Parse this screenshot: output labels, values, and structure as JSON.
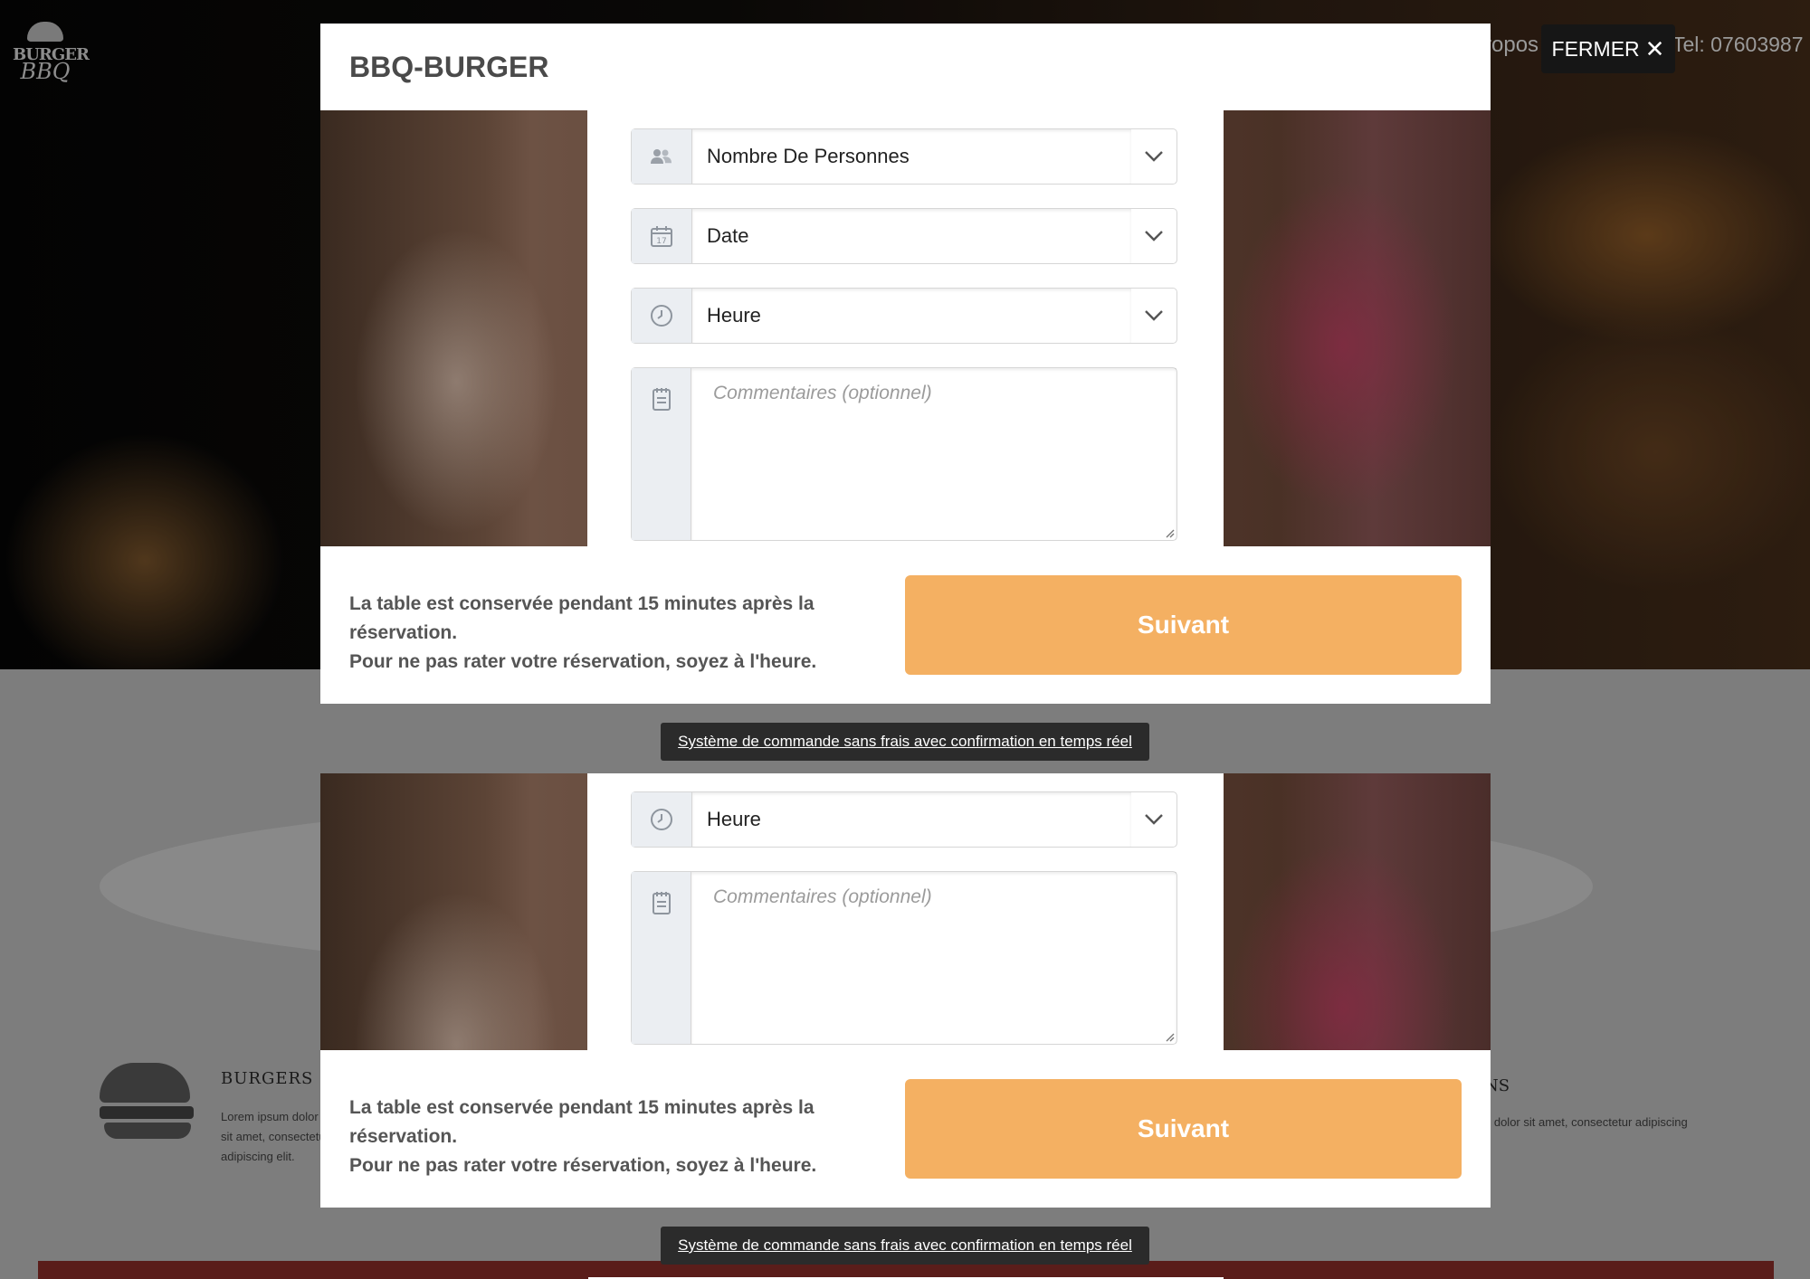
{
  "background": {
    "logo": {
      "word": "BURGER",
      "script": "BBQ"
    },
    "nav": {
      "about_fragment": "ropos",
      "phone": "Tel: 07603987"
    },
    "categories": [
      {
        "title": "BURGERS",
        "text": "Lorem ipsum dolor sit amet, consectetur adipiscing elit."
      },
      {
        "title": "NS",
        "text": "n dolor sit amet, consectetur adipiscing"
      }
    ]
  },
  "modal": {
    "title": "BBQ-BURGER",
    "close_label": "FERMER",
    "form": {
      "guests": {
        "value": "Nombre De Personnes",
        "icon": "people-icon"
      },
      "date": {
        "value": "Date",
        "icon": "calendar-icon",
        "day": "17"
      },
      "time": {
        "value": "Heure",
        "icon": "clock-icon"
      },
      "comments": {
        "placeholder": "Commentaires (optionnel)",
        "icon": "notepad-icon"
      }
    },
    "footer": {
      "note_line1": "La table est conservée pendant 15 minutes après la réservation.",
      "note_line2": "Pour ne pas rater votre réservation, soyez à l'heure.",
      "next_label": "Suivant"
    },
    "promo": "Système de commande sans frais avec confirmation en temps réel"
  },
  "colors": {
    "accent": "#f4b062",
    "header_text": "#4a4a4a",
    "addon_bg": "#ebeef2",
    "promo_bg": "#2b2b2b"
  }
}
